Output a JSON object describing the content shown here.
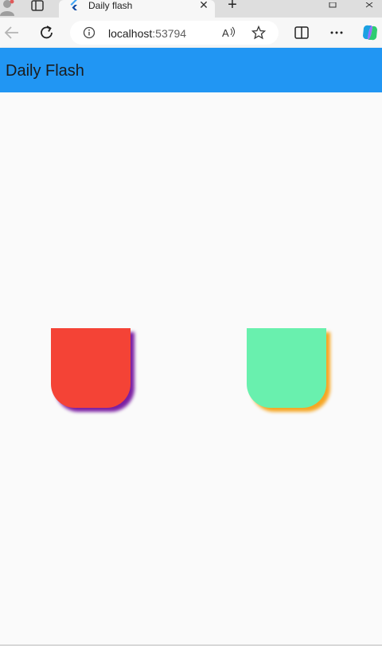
{
  "browser": {
    "tab": {
      "title": "Daily flash",
      "close": "✕"
    },
    "new_tab": "+",
    "address": {
      "host": "localhost",
      "port": ":53794"
    },
    "icons": {
      "profile": "profile-icon",
      "workspaces": "workspaces-icon",
      "favicon": "flutter-favicon-icon",
      "back": "back-arrow-icon",
      "refresh": "refresh-icon",
      "info": "info-icon",
      "read_aloud": "read-aloud-icon",
      "favorite": "star-icon",
      "split": "split-screen-icon",
      "more": "more-dots-icon",
      "copilot": "copilot-icon"
    }
  },
  "app": {
    "title": "Daily Flash",
    "colors": {
      "appbar": "#2196f3",
      "background": "#fafafa"
    },
    "cards": [
      {
        "fill": "#f44336",
        "shadow": "#7b1fa2"
      },
      {
        "fill": "#69f0ae",
        "shadow": "#f5a623"
      }
    ]
  }
}
